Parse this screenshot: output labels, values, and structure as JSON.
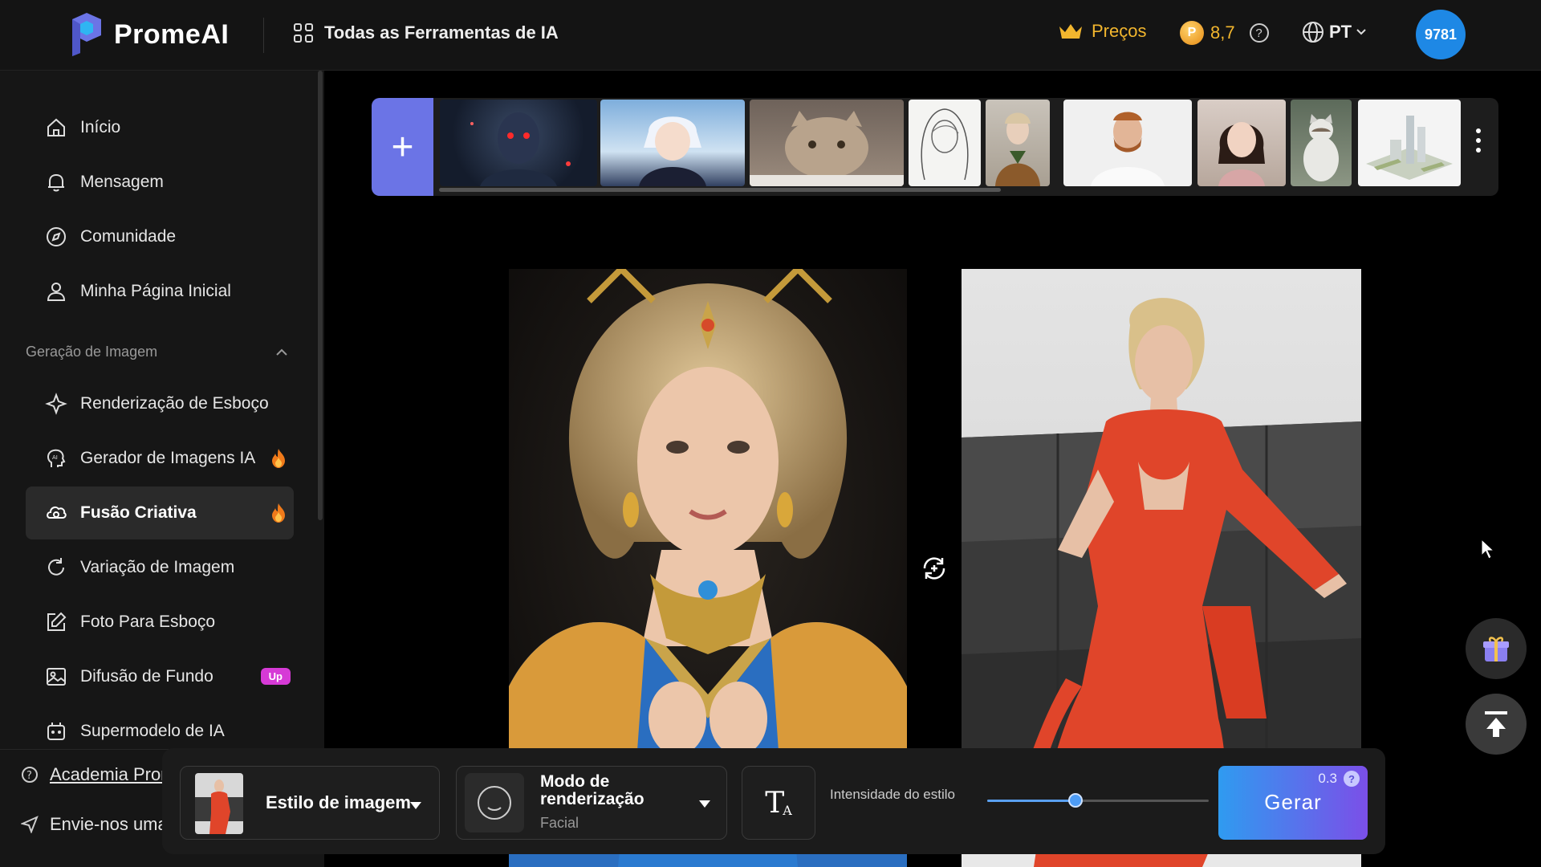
{
  "header": {
    "logo_text": "PromeAI",
    "all_tools": "Todas as Ferramentas de IA",
    "pricing": "Preços",
    "credits": "8,7",
    "coin_glyph": "P",
    "help_glyph": "?",
    "language": "PT",
    "avatar_text": "9781",
    "brand_color": "#6b74e6",
    "accent_color": "#f2b62e"
  },
  "sidebar": {
    "top_items": [
      {
        "label": "Início",
        "icon": "home-icon"
      },
      {
        "label": "Mensagem",
        "icon": "bell-icon"
      },
      {
        "label": "Comunidade",
        "icon": "compass-icon"
      },
      {
        "label": "Minha Página Inicial",
        "icon": "user-icon"
      }
    ],
    "section_title": "Geração de Imagem",
    "section_items": [
      {
        "label": "Renderização de Esboço",
        "icon": "sparkle-icon"
      },
      {
        "label": "Gerador de Imagens IA",
        "icon": "ai-head-icon",
        "hot": true
      },
      {
        "label": "Fusão Criativa",
        "icon": "fusion-icon",
        "hot": true,
        "active": true
      },
      {
        "label": "Variação de Imagem",
        "icon": "refresh-icon"
      },
      {
        "label": "Foto Para Esboço",
        "icon": "edit-icon"
      },
      {
        "label": "Difusão de Fundo",
        "icon": "image-icon",
        "badge": "Up"
      },
      {
        "label": "Supermodelo de IA",
        "icon": "robot-icon"
      }
    ],
    "bottom_links": [
      {
        "label": "Academia Prom",
        "icon": "help-icon"
      },
      {
        "label": "Envie-nos uma",
        "icon": "send-icon"
      }
    ]
  },
  "strip": {
    "add_glyph": "+",
    "thumbnails": [
      "thumb-dark-fantasy-warrior",
      "thumb-anime-white-hair",
      "thumb-cat",
      "thumb-sketch-girl",
      "thumb-woman-coat",
      "thumb-bearded-man",
      "thumb-child",
      "thumb-cat-sitting",
      "thumb-city-model"
    ]
  },
  "controls": {
    "style_label": "Estilo de imagem",
    "render_title": "Modo de renderização",
    "render_value": "Facial",
    "text_tool_glyph": "T",
    "intensity_label": "Intensidade do estilo",
    "intensity_value": 0.4,
    "generate_label": "Gerar",
    "generate_cost": "0.3",
    "generate_help": "?"
  }
}
